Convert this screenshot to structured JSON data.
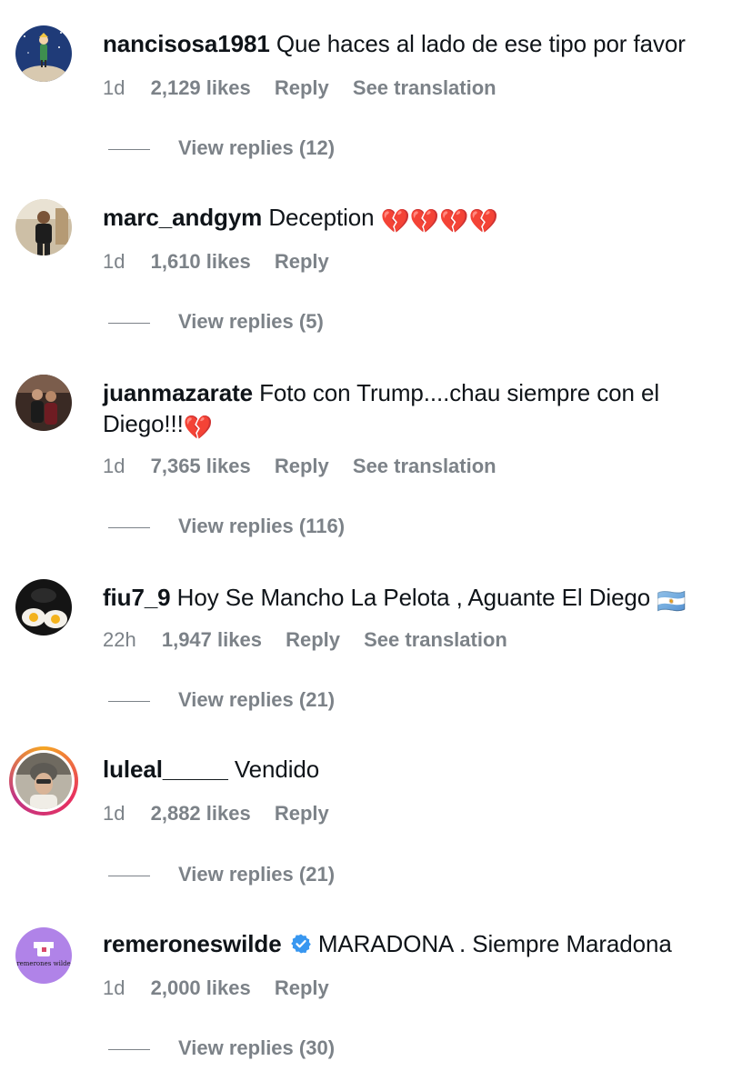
{
  "comments": [
    {
      "username": "nancisosa1981",
      "text": "Que haces al lado de ese tipo por favor",
      "time": "1d",
      "likes": "2,129 likes",
      "reply": "Reply",
      "translation": "See translation",
      "view_replies": "View replies (12)"
    },
    {
      "username": "marc_andgym",
      "text": "Deception",
      "emoji": "💔💔💔💔",
      "time": "1d",
      "likes": "1,610 likes",
      "reply": "Reply",
      "view_replies": "View replies (5)"
    },
    {
      "username": "juanmazarate",
      "text": "Foto con Trump....chau siempre con el Diego!!!",
      "emoji": "💔",
      "time": "1d",
      "likes": "7,365 likes",
      "reply": "Reply",
      "translation": "See translation",
      "view_replies": "View replies (116)"
    },
    {
      "username": "fiu7_9",
      "text": "Hoy Se Mancho La Pelota , Aguante El Diego",
      "emoji": "🇦🇷",
      "time": "22h",
      "likes": "1,947 likes",
      "reply": "Reply",
      "translation": "See translation",
      "view_replies": "View replies (21)"
    },
    {
      "username": "luleal_____",
      "text": "Vendido",
      "time": "1d",
      "likes": "2,882 likes",
      "reply": "Reply",
      "view_replies": "View replies (21)"
    },
    {
      "username": "remeroneswilde",
      "text": "MARADONA . Siempre Maradona",
      "time": "1d",
      "likes": "2,000 likes",
      "reply": "Reply",
      "view_replies": "View replies (30)",
      "avatar_text": "remerones wilde"
    }
  ],
  "colors": {
    "meta_text": "#7c8288",
    "verified_badge": "#3897f0",
    "story_ring": "#e8305f"
  },
  "icons": {
    "verified": "verified-badge-icon"
  }
}
